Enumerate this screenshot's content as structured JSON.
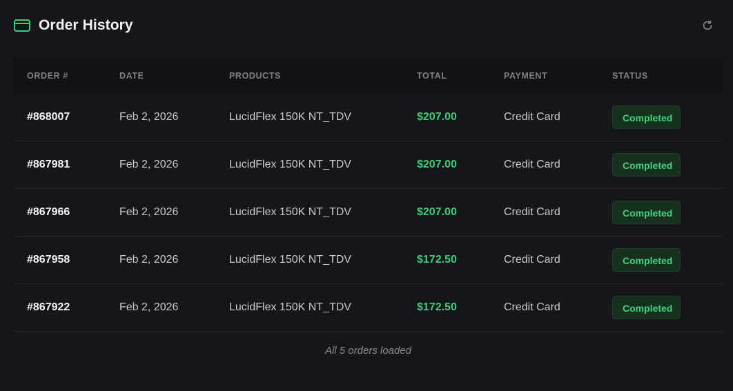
{
  "header": {
    "title": "Order History",
    "icon": "credit-card-icon",
    "refresh_icon": "refresh-icon"
  },
  "colors": {
    "background": "#15161a",
    "accent_green": "#3ccf7a",
    "badge_bg": "#17301f"
  },
  "table": {
    "columns": [
      "ORDER #",
      "DATE",
      "PRODUCTS",
      "TOTAL",
      "PAYMENT",
      "STATUS"
    ],
    "rows": [
      {
        "order": "#868007",
        "date": "Feb 2, 2026",
        "product": "LucidFlex 150K NT_TDV",
        "total": "$207.00",
        "payment": "Credit Card",
        "status": "Completed"
      },
      {
        "order": "#867981",
        "date": "Feb 2, 2026",
        "product": "LucidFlex 150K NT_TDV",
        "total": "$207.00",
        "payment": "Credit Card",
        "status": "Completed"
      },
      {
        "order": "#867966",
        "date": "Feb 2, 2026",
        "product": "LucidFlex 150K NT_TDV",
        "total": "$207.00",
        "payment": "Credit Card",
        "status": "Completed"
      },
      {
        "order": "#867958",
        "date": "Feb 2, 2026",
        "product": "LucidFlex 150K NT_TDV",
        "total": "$172.50",
        "payment": "Credit Card",
        "status": "Completed"
      },
      {
        "order": "#867922",
        "date": "Feb 2, 2026",
        "product": "LucidFlex 150K NT_TDV",
        "total": "$172.50",
        "payment": "Credit Card",
        "status": "Completed"
      }
    ]
  },
  "footer": {
    "text": "All 5 orders loaded"
  }
}
